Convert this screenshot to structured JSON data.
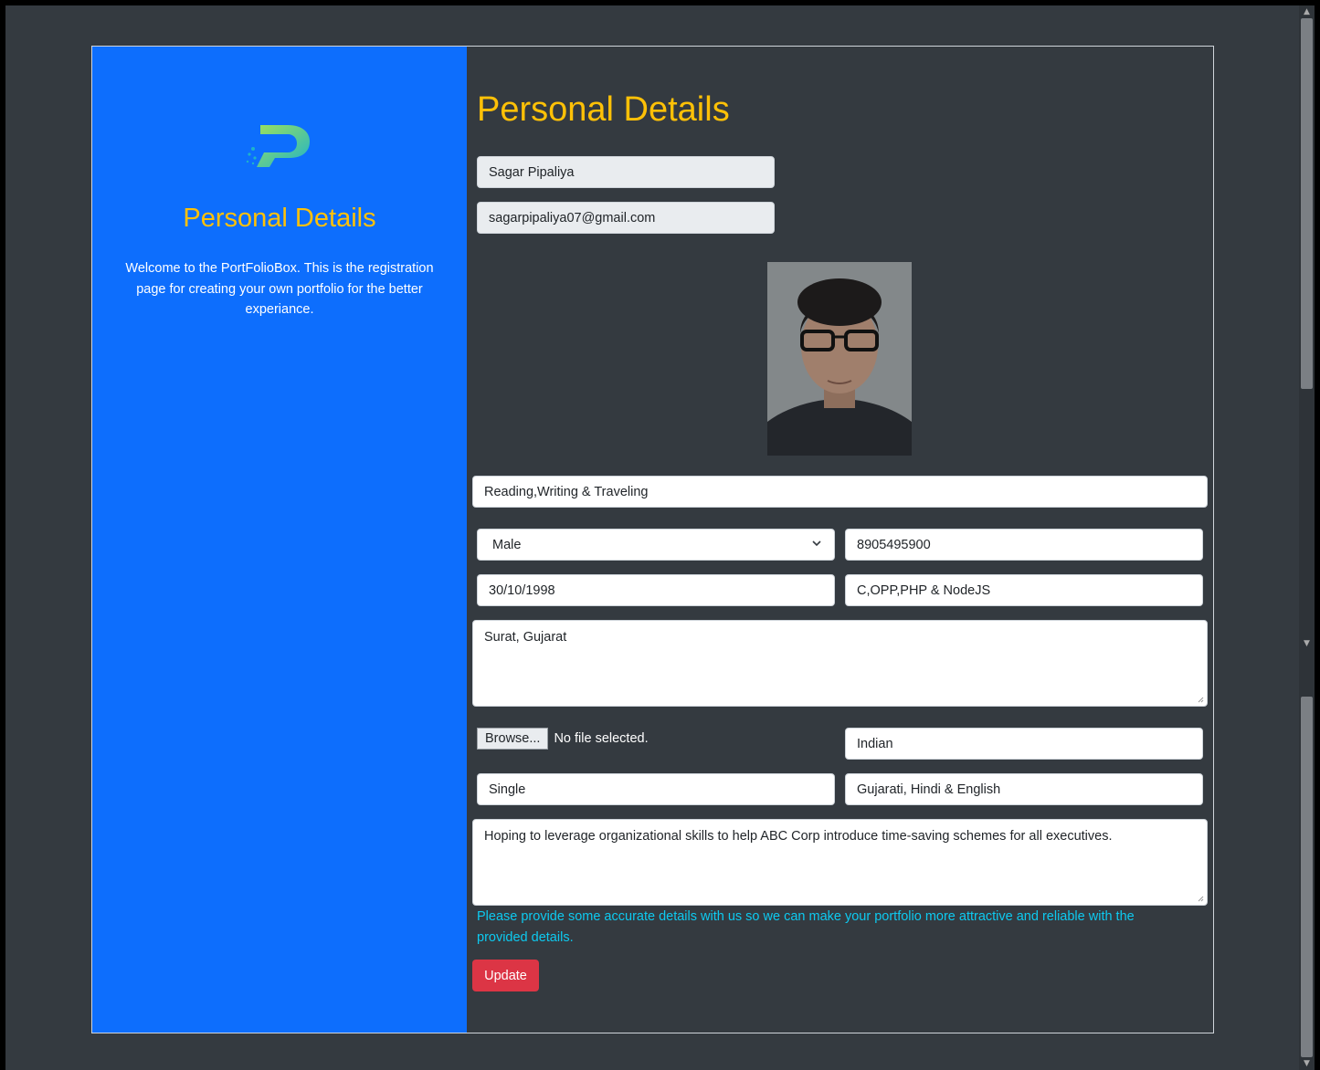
{
  "sidebar": {
    "heading": "Personal Details",
    "description": "Welcome to the PortFolioBox. This is the registration page for creating your own portfolio for the better experiance.",
    "logo_icon": "portfoliobox-p-logo"
  },
  "form": {
    "title": "Personal Details",
    "name": "Sagar Pipaliya",
    "email": "sagarpipaliya07@gmail.com",
    "hobbies": "Reading,Writing & Traveling",
    "gender": "Male",
    "phone": "8905495900",
    "dob": "30/10/1998",
    "skills": "C,OPP,PHP & NodeJS",
    "address": "Surat, Gujarat",
    "file_button": "Browse...",
    "file_status": "No file selected.",
    "nationality": "Indian",
    "marital_status": "Single",
    "languages": "Gujarati, Hindi & English",
    "objective": "Hoping to leverage organizational skills to help ABC Corp introduce time-saving schemes for all executives.",
    "note": "Please provide some accurate details with us so we can make your portfolio more attractive and reliable with the provided details.",
    "update_button": "Update"
  },
  "colors": {
    "sidebar_bg": "#0d6efd",
    "page_bg": "#343a40",
    "heading": "#ffc107",
    "note": "#0dcaf0",
    "button": "#dc3545"
  }
}
